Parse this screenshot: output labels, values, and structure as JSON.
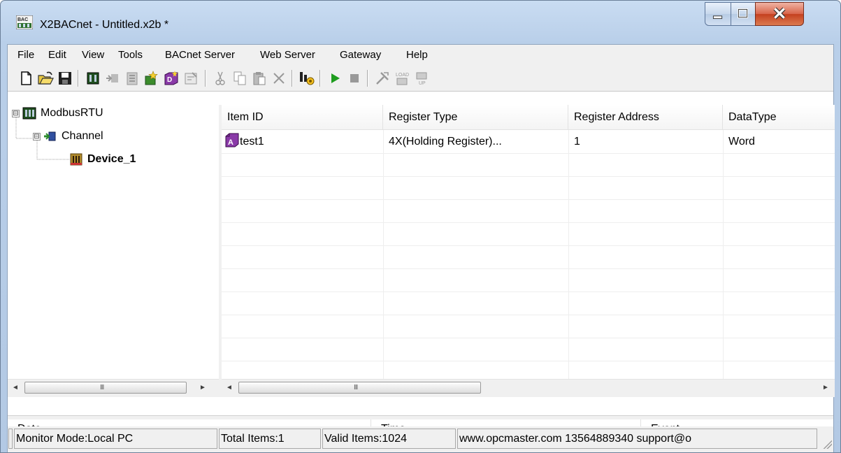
{
  "window": {
    "app_icon": "bacnet-app-icon",
    "title": "X2BACnet - Untitled.x2b *",
    "controls": [
      "minimize-icon",
      "maximize-icon",
      "close-icon"
    ]
  },
  "menu": {
    "items": [
      "File",
      "Edit",
      "View",
      "Tools",
      "BACnet Server",
      "Web Server",
      "Gateway",
      "Help"
    ]
  },
  "toolbar": {
    "buttons": [
      "new-icon",
      "open-icon",
      "save-icon",
      "new-channel-icon",
      "new-device-icon",
      "new-group-icon",
      "new-item-icon",
      "new-bacnet-object-icon",
      "properties-icon",
      "cut-icon",
      "copy-icon",
      "paste-icon",
      "delete-icon",
      "settings-icon",
      "run-icon",
      "stop-icon",
      "tools-icon",
      "load-icon",
      "unload-icon"
    ]
  },
  "tree": {
    "root": {
      "label": "ModbusRTU",
      "icon": "modbus-rtu-icon",
      "expander": "⊟"
    },
    "channel": {
      "label": "Channel",
      "icon": "channel-icon",
      "expander": "⊟"
    },
    "device": {
      "label": "Device_1",
      "icon": "device-icon"
    }
  },
  "list": {
    "columns": [
      "Item ID",
      "Register Type",
      "Register Address",
      "DataType"
    ],
    "rows": [
      {
        "item_id": "test1",
        "register_type": "4X(Holding Register)...",
        "register_address": "1",
        "data_type": "Word",
        "icon": "analog-item-icon"
      }
    ]
  },
  "scroll": {
    "left_arrow": "◄",
    "right_arrow": "►",
    "grip": "III"
  },
  "log": {
    "columns": [
      "Date",
      "Time",
      "Event"
    ]
  },
  "status": {
    "panels": [
      "Monitor Mode:Local PC",
      "Total Items:1",
      "Valid Items:1024",
      "www.opcmaster.com 13564889340 support@o"
    ]
  },
  "colors": {
    "title_bar": "#b9cfe9",
    "close_button": "#c4401f",
    "run_green": "#1e9c1e",
    "item_purple": "#8a3aa8"
  }
}
